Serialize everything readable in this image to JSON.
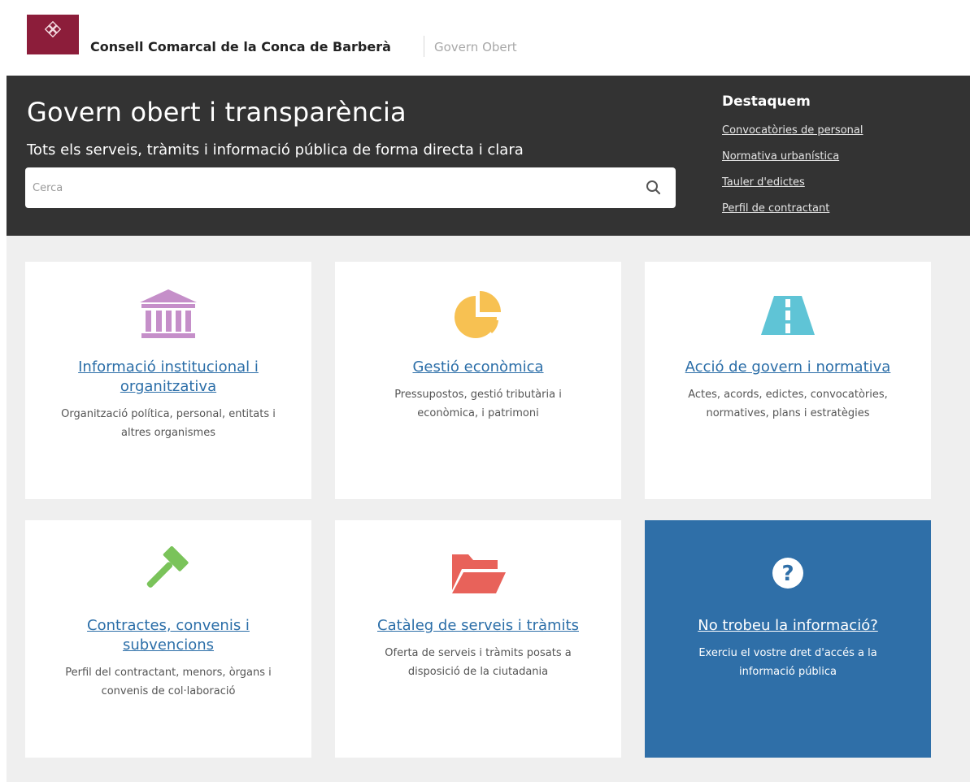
{
  "header": {
    "org_name": "Consell Comarcal de la Conca de Barberà",
    "portal_name": "Govern Obert"
  },
  "hero": {
    "title": "Govern obert i transparència",
    "subtitle": "Tots els serveis, tràmits i informació pública de forma directa i clara",
    "search_placeholder": "Cerca",
    "search_value": ""
  },
  "destaquem": {
    "heading": "Destaquem",
    "links": [
      "Convocatòries de personal",
      "Normativa urbanística",
      "Tauler d'edictes",
      "Perfil de contractant"
    ]
  },
  "cards": [
    {
      "icon": "institution-building-icon",
      "title": "Informació institucional i organitzativa",
      "desc": "Organització política, personal, entitats i altres organismes"
    },
    {
      "icon": "pie-chart-icon",
      "title": "Gestió econòmica",
      "desc": "Pressupostos, gestió tributària i econòmica, i patrimoni"
    },
    {
      "icon": "road-icon",
      "title": "Acció de govern i normativa",
      "desc": "Actes, acords, edictes, convocatòries, normatives, plans i estratègies"
    },
    {
      "icon": "gavel-icon",
      "title": "Contractes, convenis i subvencions",
      "desc": "Perfil del contractant, menors, òrgans i convenis de col·laboració"
    },
    {
      "icon": "folder-open-icon",
      "title": "Catàleg de serveis i tràmits",
      "desc": "Oferta de serveis i tràmits posats a disposició de la ciutadania"
    },
    {
      "icon": "question-circle-icon",
      "title": "No trobeu la informació?",
      "desc": "Exerciu el vostre dret d'accés a la informació pública"
    }
  ],
  "colors": {
    "brand": "#8c1d3a",
    "hero_bg": "#333333",
    "link": "#2b6ea8",
    "highlight_card": "#2f6fa8",
    "icon_institution": "#c58fc9",
    "icon_economy": "#f7c152",
    "icon_road": "#5fc4d6",
    "icon_gavel": "#7ac35a",
    "icon_folder": "#e8625a"
  }
}
